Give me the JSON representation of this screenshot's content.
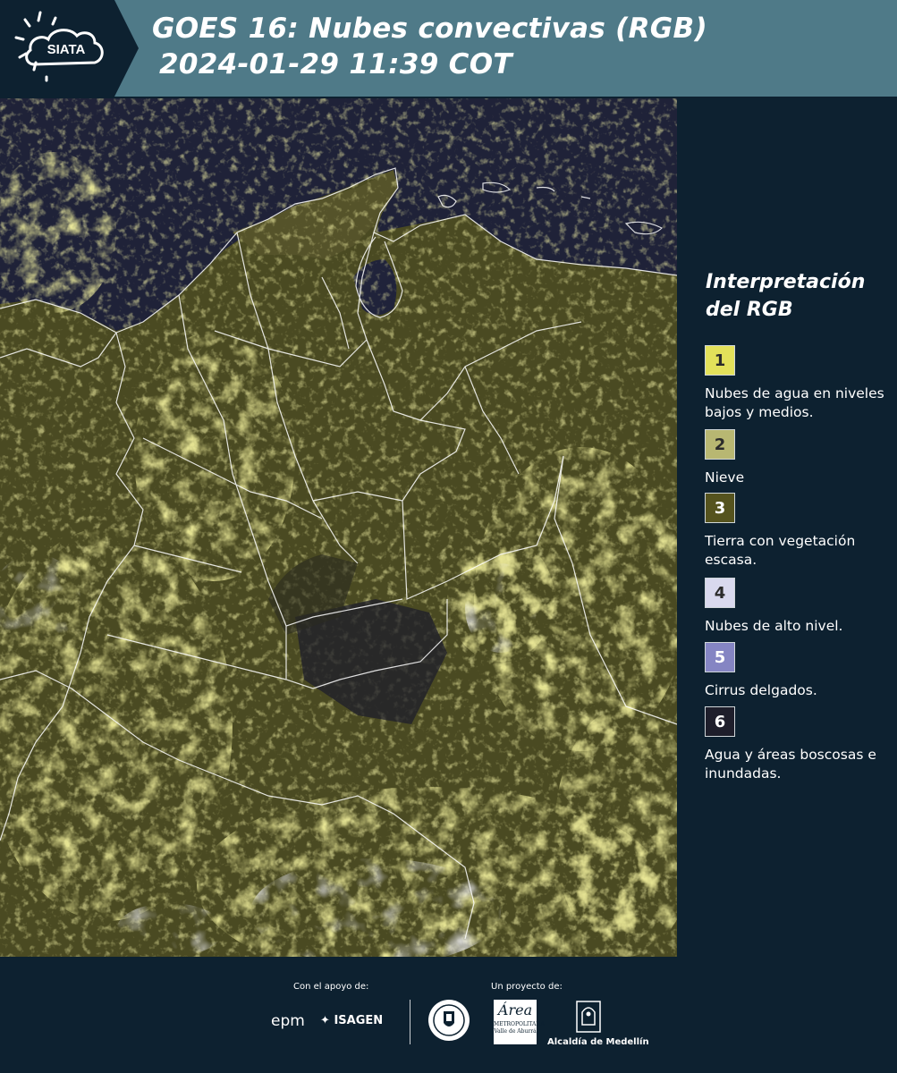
{
  "header": {
    "logo_text": "SIATA",
    "title_line1": "GOES 16: Nubes convectivas (RGB)",
    "title_line2": "2024-01-29 11:39 COT"
  },
  "legend": {
    "title": "Interpretación del RGB",
    "items": [
      {
        "number": "1",
        "label": "Nubes de agua en niveles bajos y medios.",
        "color": "#e3e15a"
      },
      {
        "number": "2",
        "label": "Nieve",
        "color": "#b8b772"
      },
      {
        "number": "3",
        "label": "Tierra con vegetación escasa.",
        "color": "#55531e"
      },
      {
        "number": "4",
        "label": "Nubes de alto nivel.",
        "color": "#d9d9ee"
      },
      {
        "number": "5",
        "label": "Cirrus delgados.",
        "color": "#8585c3"
      },
      {
        "number": "6",
        "label": "Agua y áreas boscosas e inundadas.",
        "color": "#1e1e2b"
      }
    ]
  },
  "footer": {
    "support_caption": "Con el apoyo de:",
    "project_caption": "Un proyecto de:",
    "sponsor_epm": "epm",
    "sponsor_isagen": "ISAGEN",
    "partner_metropolitana": "Área",
    "partner_metropolitana_sub": "METROPOLITANA",
    "partner_metropolitana_sub2": "Valle de Aburrá",
    "partner_alcaldia": "Alcaldía de Medellín"
  },
  "colors": {
    "header_bg": "#4f7a88",
    "page_bg": "#0d2130",
    "ocean": "#1f2238",
    "land": "#4a4a22",
    "cloud_low": "#e6e35a",
    "cloud_high": "#d8d8ea",
    "border_lines": "#ffffff"
  }
}
